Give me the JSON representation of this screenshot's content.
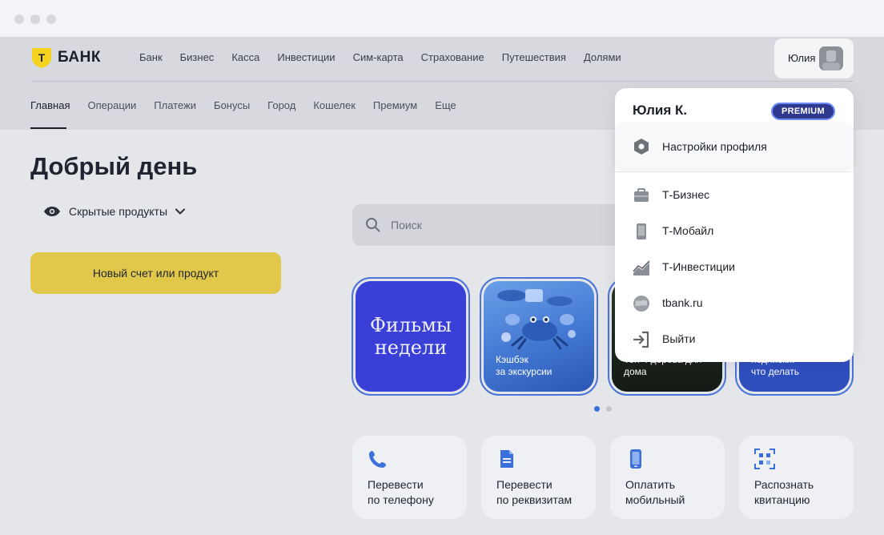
{
  "window": {
    "controls": [
      "close",
      "minimize",
      "maximize"
    ]
  },
  "brand": {
    "logo_letter": "Т",
    "name": "БАНК",
    "accent": "#f5d31e"
  },
  "topnav": [
    "Банк",
    "Бизнес",
    "Касса",
    "Инвестиции",
    "Сим-карта",
    "Страхование",
    "Путешествия",
    "Долями"
  ],
  "subnav": {
    "items": [
      "Главная",
      "Операции",
      "Платежи",
      "Бонусы",
      "Город",
      "Кошелек",
      "Премиум",
      "Еще"
    ],
    "active": "Главная"
  },
  "user": {
    "short_name": "Юлия",
    "avatar_icon": "user-avatar"
  },
  "main": {
    "greeting": "Добрый день",
    "hidden_products": "Скрытые продукты",
    "new_account": "Новый счет или продукт",
    "search_placeholder": "Поиск"
  },
  "stories": [
    {
      "title": "Фильмы\nнедели",
      "caption": ""
    },
    {
      "title": "",
      "caption": "Кэшбэк\nза экскурсии"
    },
    {
      "title": "",
      "caption": "Топ-4 дерева для\nдома"
    },
    {
      "title": "",
      "caption": "подписки:\nчто делать"
    }
  ],
  "pager": {
    "count": 2,
    "active_index": 0,
    "active_color": "#3b6fdc",
    "inactive_color": "#c3c6cc"
  },
  "quick_actions": [
    {
      "label": "Перевести\nпо телефону",
      "icon": "phone-icon"
    },
    {
      "label": "Перевести\nпо реквизитам",
      "icon": "document-icon"
    },
    {
      "label": "Оплатить\nмобильный",
      "icon": "mobile-icon"
    },
    {
      "label": "Распознать\nквитанцию",
      "icon": "qr-scan-icon"
    }
  ],
  "dropdown": {
    "name": "Юлия К.",
    "badge": "PREMIUM",
    "items": [
      {
        "label": "Настройки профиля",
        "icon": "settings-icon"
      },
      {
        "label": "Т-Бизнес",
        "icon": "briefcase-icon"
      },
      {
        "label": "Т-Мобайл",
        "icon": "phone-device-icon"
      },
      {
        "label": "Т-Инвестиции",
        "icon": "chart-icon"
      },
      {
        "label": "tbank.ru",
        "icon": "globe-icon"
      },
      {
        "label": "Выйти",
        "icon": "logout-icon"
      }
    ]
  }
}
